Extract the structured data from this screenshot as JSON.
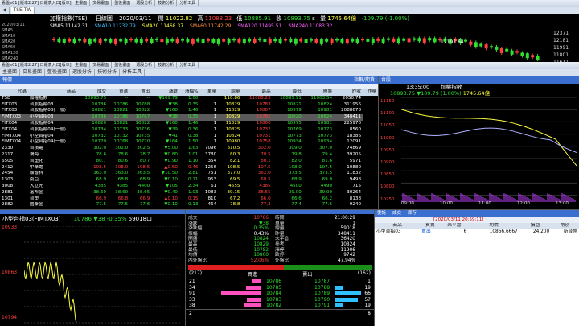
{
  "titlebar": {
    "title": "看盤e01 [版本2.27] 日報表入口[版本]",
    "tabs": [
      "主畫面",
      "交易畫面",
      "盤後畫面",
      "選股分析",
      "技術分析",
      "分析工具"
    ],
    "extra": "TSE.TW"
  },
  "topchart": {
    "date": "2020/03/11",
    "name": "加權指數(TSE)",
    "period": "日線圖",
    "open_label": "開",
    "open": "11022.82",
    "high_label": "高",
    "high": "11088.23",
    "low_label": "低",
    "low": "10885.91",
    "close_label": "收",
    "close": "10893.75",
    "unit": "s",
    "vol_label": "量",
    "vol": "1745.64億",
    "change": "-109.79 (-1.00%)",
    "ma": [
      {
        "label": "SMA5",
        "value": "11142.31",
        "color": "#ffffff"
      },
      {
        "label": "SMA10",
        "value": "11232.79",
        "color": "#40c0ff"
      },
      {
        "label": "SMA20",
        "value": "11468.37",
        "color": "#ffff40"
      },
      {
        "label": "SMA60",
        "value": "11742.29",
        "color": "#ff9040"
      },
      {
        "label": "SMA120",
        "value": "11495.51",
        "color": "#ff60ff"
      },
      {
        "label": "SMA240",
        "value": "11083.32",
        "color": "#ff60ff"
      }
    ],
    "left_labels": [
      "2020/03/11",
      "SMA5",
      "SMA10",
      "SMA20",
      "SMA60",
      "SMA120",
      "SMA240"
    ],
    "peak_label": "12197.64",
    "yaxis": [
      "12371",
      "12181",
      "11991",
      "11801",
      "11611",
      "11421"
    ]
  },
  "quote": {
    "title": "報價",
    "right_title": "指數/期貨",
    "headers": [
      "代碼",
      "商品",
      "成交",
      "買進",
      "賣出",
      "漲跌",
      "漲幅%",
      "單量",
      "總量",
      "最高",
      "最低",
      "開盤",
      "昨收",
      "昨量"
    ],
    "rows": [
      [
        "TSE",
        "加權指數",
        "10893.75",
        "--",
        "--",
        "▼109.79",
        "1.00",
        "",
        "110.86",
        "11088.23",
        "10885.91",
        "11003.54",
        "2050.74"
      ],
      [
        "FITX03",
        "台股指期03",
        "10786",
        "10786",
        "10788",
        "▼38",
        "0.35",
        "1",
        "10829",
        "10783",
        "10821",
        "10824",
        "311956"
      ],
      [
        "FITX03",
        "台股指期03(一般)",
        "10821",
        "10821",
        "10822",
        "▼160",
        "1.46",
        "1",
        "11029",
        "10807",
        "10979",
        "10981",
        "2088678"
      ],
      [
        "FIMTX03",
        "小型台指03",
        "10786",
        "10786",
        "10787",
        "▼38",
        "0.35",
        "1",
        "10829",
        "10782",
        "10820",
        "10824",
        "348411"
      ],
      [
        "FITX04",
        "台股指期04",
        "10820",
        "10821",
        "10822",
        "▼160",
        "1.46",
        "1",
        "11029",
        "10800",
        "10975",
        "10981",
        "225970"
      ],
      [
        "FITX04",
        "台股指期04(一般)",
        "10734",
        "10733",
        "10736",
        "▼39",
        "0.36",
        "1",
        "10825",
        "10732",
        "10769",
        "10773",
        "8560"
      ],
      [
        "FIMTX04",
        "小型台指04",
        "10732",
        "10732",
        "10735",
        "▼41",
        "0.38",
        "1",
        "10824",
        "10731",
        "10773",
        "10773",
        "18386"
      ],
      [
        "FIMTX04",
        "小型台指04(一般)",
        "10770",
        "10768",
        "10770",
        "▼164",
        "1.50",
        "1",
        "10980",
        "10758",
        "10934",
        "10934",
        "12091"
      ],
      [
        "2330",
        "台積電",
        "302.0",
        "302.0",
        "302.5",
        "▼5.00",
        "1.63",
        "7096",
        "310.5",
        "302.0",
        "309.0",
        "307.0",
        "74869"
      ],
      [
        "2317",
        "鴻海",
        "78.6",
        "78.6",
        "78.7",
        "▼0.80",
        "1.01",
        "3780",
        "80.3",
        "78.5",
        "79.8",
        "79.4",
        "39205"
      ],
      [
        "6505",
        "台塑化",
        "80.7",
        "80.6",
        "80.7",
        "▼0.90",
        "1.10",
        "354",
        "82.1",
        "80.1",
        "82.0",
        "81.6",
        "5971"
      ],
      [
        "2412",
        "中華電",
        "108.5",
        "108.0",
        "108.5",
        "▲0.50",
        "0.46",
        "1256",
        "108.5",
        "107.5",
        "108.0",
        "107.5",
        "10880"
      ],
      [
        "2454",
        "聯發科",
        "363.0",
        "363.0",
        "363.5",
        "▼10.50",
        "2.81",
        "751",
        "377.0",
        "362.0",
        "373.5",
        "373.5",
        "11832"
      ],
      [
        "1303",
        "南亞",
        "68.9",
        "68.8",
        "68.9",
        "▼0.10",
        "0.11",
        "953",
        "69.5",
        "68.5",
        "68.9",
        "69.0",
        "9498"
      ],
      [
        "3008",
        "大立光",
        "4385",
        "4385",
        "4400",
        "▼105",
        "2.34",
        "61",
        "4555",
        "4385",
        "4500",
        "4490",
        "715"
      ],
      [
        "2881",
        "富邦金",
        "38.60",
        "38.60",
        "38.65",
        "▼0.40",
        "1.03",
        "1083",
        "39.15",
        "38.55",
        "39.00",
        "39.00",
        "30264"
      ],
      [
        "1301",
        "台塑",
        "66.9",
        "66.8",
        "66.9",
        "▲0.10",
        "0.15",
        "810",
        "67.2",
        "66.0",
        "66.6",
        "66.2",
        "8138"
      ],
      [
        "2882",
        "國泰金",
        "77.5",
        "77.5",
        "77.6",
        "▼0.10",
        "0.13",
        "464",
        "78.8",
        "77.3",
        "77.4",
        "77.6",
        "9240"
      ]
    ]
  },
  "intraday": {
    "title": "台股",
    "time": "13:35:00",
    "name": "加權指數",
    "value": "10893.75",
    "change": "▼109.79 (1.00%)",
    "vol": "1745.64億",
    "yaxis": [
      "11150",
      "11100",
      "11050",
      "11000",
      "10950",
      "10900",
      "10850",
      "10800",
      "10750"
    ],
    "xaxis": [
      "09:00",
      "10:00",
      "11:00",
      "12:00",
      "13:00"
    ]
  },
  "tick": {
    "title": "小型台指03(FIMTX03)",
    "price": "10786",
    "change": "▼38",
    "pct": "-0.35%",
    "vol": "59018口",
    "yaxis": [
      "10933",
      "10863",
      "10794"
    ]
  },
  "detail": {
    "left": [
      [
        "成交",
        "10786",
        "up"
      ],
      [
        "漲跌",
        "▼38",
        "dn"
      ],
      [
        "漲跌幅",
        "-0.35%",
        "dn"
      ],
      [
        "振幅",
        "0.43%",
        "wh"
      ],
      [
        "開盤",
        "10824",
        "dn"
      ],
      [
        "最高",
        "10829",
        "dn"
      ],
      [
        "最低",
        "10782",
        "dn"
      ],
      [
        "均價",
        "10800",
        "dn"
      ],
      [
        "內外盤比",
        "52.06%",
        "up"
      ]
    ],
    "right": [
      [
        "時間",
        "21:00:29"
      ],
      [
        "單量",
        "1"
      ],
      [
        "總量",
        "59018"
      ],
      [
        "昨量",
        "348411"
      ],
      [
        "未平倉",
        "36420"
      ],
      [
        "參考",
        "10824"
      ],
      [
        "漲停",
        "11906"
      ],
      [
        "跌停",
        "9742"
      ],
      [
        "外盤比",
        "47.94%"
      ]
    ],
    "bid_total": "(217)",
    "ask_total": "(162)",
    "bid_head": "買進",
    "ask_head": "賣出",
    "book": [
      [
        "21",
        "10786",
        "10787",
        "1"
      ],
      [
        "34",
        "10785",
        "10788",
        "19"
      ],
      [
        "91",
        "10784",
        "10789",
        "66"
      ],
      [
        "33",
        "10783",
        "10790",
        "57"
      ],
      [
        "38",
        "10782",
        "10791",
        "19"
      ]
    ],
    "bid_sum": "2",
    "ask_sum": "8"
  },
  "orders": {
    "tabs": [
      "委託",
      "成交",
      "庫存"
    ],
    "headers": [
      "商品",
      "買賣",
      "未平倉",
      "均價",
      "損益",
      "幣別"
    ],
    "time": "[2020/03/11 20:59:11]",
    "rows": [
      [
        "小型台指03",
        "賣出",
        "6",
        "10866.6667",
        "24,200",
        "新台幣"
      ]
    ]
  }
}
